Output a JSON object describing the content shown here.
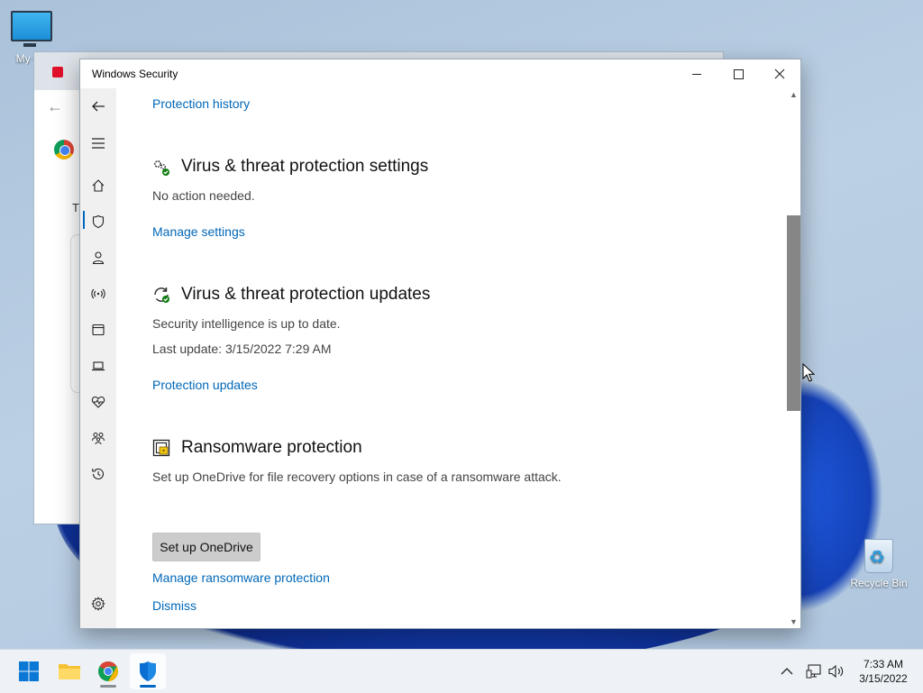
{
  "desktop": {
    "icons": [
      {
        "label": "My Co"
      },
      {
        "label": "Recycle Bin"
      }
    ]
  },
  "background_window": {
    "first_char": "T"
  },
  "window": {
    "title": "Windows Security",
    "controls": {
      "minimize": "–",
      "maximize": "□",
      "close": "✕"
    }
  },
  "nav": {
    "items": [
      "back-arrow-icon",
      "hamburger-icon",
      "home-icon",
      "shield-icon",
      "person-icon",
      "wireless-icon",
      "app-browser-icon",
      "laptop-icon",
      "heart-icon",
      "family-icon",
      "history-icon",
      "settings-icon"
    ],
    "active_index": 3
  },
  "content": {
    "protection_history_link": "Protection history",
    "settings_section": {
      "title": "Virus & threat protection settings",
      "status": "No action needed.",
      "link": "Manage settings"
    },
    "updates_section": {
      "title": "Virus & threat protection updates",
      "status": "Security intelligence is up to date.",
      "last_update": "Last update: 3/15/2022 7:29 AM",
      "link": "Protection updates"
    },
    "ransomware_section": {
      "title": "Ransomware protection",
      "description": "Set up OneDrive for file recovery options in case of a ransomware attack.",
      "button": "Set up OneDrive",
      "manage_link": "Manage ransomware protection",
      "dismiss_link": "Dismiss"
    }
  },
  "colors": {
    "link": "#0067b8",
    "accent": "#0067c0",
    "status_ok": "#107c10"
  },
  "taskbar": {
    "apps": [
      "windows-start-icon",
      "file-explorer-icon",
      "chrome-icon",
      "windows-security-icon"
    ],
    "tray": [
      "chevron-up-icon",
      "network-icon",
      "volume-icon"
    ],
    "time": "7:33 AM",
    "date": "3/15/2022"
  }
}
